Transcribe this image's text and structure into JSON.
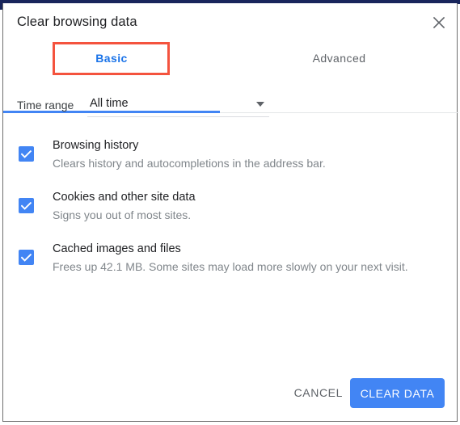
{
  "dialog": {
    "title": "Clear browsing data",
    "close_icon": "close-icon"
  },
  "tabs": [
    {
      "label": "Basic",
      "active": true,
      "highlighted": true
    },
    {
      "label": "Advanced",
      "active": false,
      "highlighted": false
    }
  ],
  "time_range": {
    "label": "Time range",
    "value": "All time",
    "arrow_icon": "chevron-down-icon"
  },
  "options": [
    {
      "title": "Browsing history",
      "description": "Clears history and autocompletions in the address bar.",
      "checked": true
    },
    {
      "title": "Cookies and other site data",
      "description": "Signs you out of most sites.",
      "checked": true
    },
    {
      "title": "Cached images and files",
      "description": "Frees up 42.1 MB. Some sites may load more slowly on your next visit.",
      "checked": true
    }
  ],
  "footer": {
    "cancel_label": "CANCEL",
    "confirm_label": "CLEAR DATA"
  },
  "colors": {
    "accent_blue": "#4285f4",
    "tab_active_text": "#1a73e8",
    "highlight_red": "#f4533e",
    "chrome_navy": "#19255c",
    "secondary_text": "#80868b"
  }
}
